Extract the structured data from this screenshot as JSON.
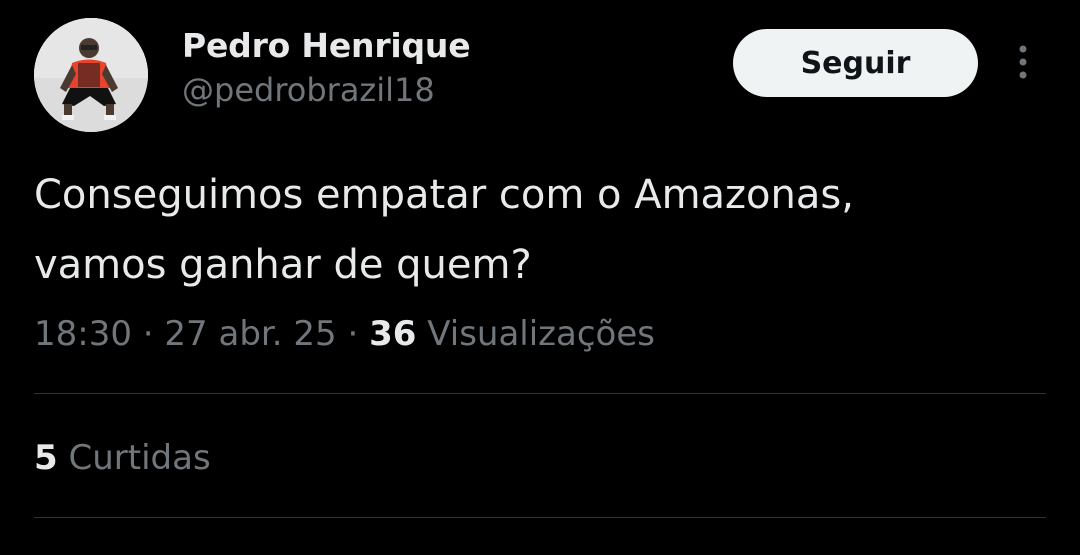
{
  "author": {
    "display_name": "Pedro Henrique",
    "handle": "@pedrobrazil18"
  },
  "follow_button": {
    "label": "Seguir"
  },
  "tweet": {
    "text": "Conseguimos empatar com o Amazonas,\nvamos ganhar de quem?"
  },
  "meta": {
    "time": "18:30",
    "separator": " · ",
    "date": "27 abr. 25",
    "views_count": "36",
    "views_label": "Visualizações"
  },
  "likes": {
    "count": "5",
    "label": "Curtidas"
  },
  "icons": {
    "more": "more-vertical-icon"
  },
  "colors": {
    "background": "#000000",
    "primary_text": "#e7e9ea",
    "secondary_text": "#71767b",
    "divider": "#2f3336",
    "follow_bg": "#eff3f4"
  }
}
